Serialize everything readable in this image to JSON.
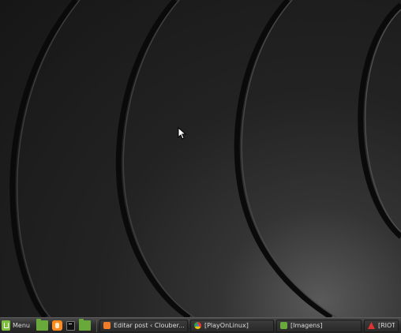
{
  "taskbar": {
    "menu_label": "Menu",
    "launchers": [
      {
        "icon": "folder-icon",
        "color": "#69a83a"
      },
      {
        "icon": "firefox-icon",
        "color": "#ff8a1f"
      },
      {
        "icon": "terminal-icon",
        "color": "#111111"
      },
      {
        "icon": "folder-icon",
        "color": "#69a83a"
      }
    ],
    "tasks": [
      {
        "icon": "blogger-icon",
        "label": "Editar post ‹ Clouber..."
      },
      {
        "icon": "chrome-icon",
        "label": "[PlayOnLinux]"
      },
      {
        "icon": "folder-icon",
        "label": "[Imagens]"
      },
      {
        "icon": "riot-icon",
        "label": "[RIOT"
      }
    ]
  },
  "colors": {
    "desktop_bg": "#161616",
    "taskbar_bg": "#2e2e2e",
    "mint_green": "#7fbf3f"
  }
}
